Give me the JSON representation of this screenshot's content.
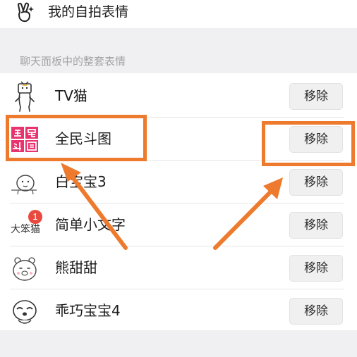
{
  "selfie_row": {
    "icon": "victory-hand-sparkle-icon",
    "label": "我的自拍表情"
  },
  "section_header": "聊天面板中的整套表情",
  "sticker_sets": [
    {
      "name": "TV猫",
      "thumb": "tv-cat-sticker-icon",
      "action": "移除"
    },
    {
      "name": "全民斗图",
      "thumb": "quanmin-doutu-logo-icon",
      "action": "移除"
    },
    {
      "name": "白宝宝3",
      "thumb": "bai-baobao-sticker-icon",
      "action": "移除"
    },
    {
      "name": "简单小文字",
      "thumb": "dabenmao-sticker-icon",
      "action": "移除",
      "badge": "1"
    },
    {
      "name": "熊甜甜",
      "thumb": "bear-tiantian-sticker-icon",
      "action": "移除"
    },
    {
      "name": "乖巧宝宝4",
      "thumb": "guaiqiao-baobao-sticker-icon",
      "action": "移除"
    }
  ],
  "colors": {
    "highlight": "#ee7a2d",
    "logo_pink": "#e8336f",
    "badge_red": "#e94a3f",
    "section_background": "#f0f0f2"
  }
}
